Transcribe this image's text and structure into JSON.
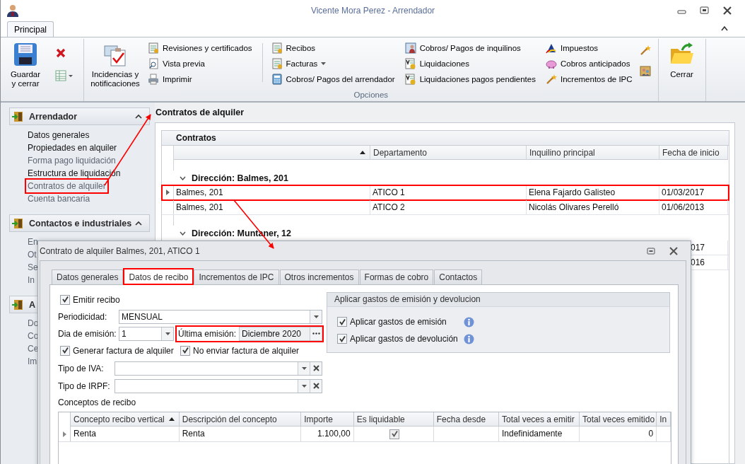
{
  "window": {
    "title": "Vicente Mora Perez - Arrendador"
  },
  "ribbon": {
    "tabs": [
      {
        "label": "Principal",
        "selected": true
      }
    ],
    "save_button": {
      "label": "Guardar y cerrar"
    },
    "main_button": {
      "label": "Incidencias y notificaciones"
    },
    "columns": [
      [
        {
          "label": "Revisiones y certificados",
          "dropdown": false
        },
        {
          "label": "Vista previa",
          "dropdown": false
        },
        {
          "label": "Imprimir",
          "dropdown": false
        }
      ],
      [
        {
          "label": "Recibos",
          "dropdown": false
        },
        {
          "label": "Facturas",
          "dropdown": true
        },
        {
          "label": "Cobros/ Pagos del arrendador",
          "dropdown": false
        }
      ],
      [
        {
          "label": "Cobros/ Pagos de inquilinos",
          "dropdown": false
        },
        {
          "label": "Liquidaciones",
          "dropdown": false
        },
        {
          "label": "Liquidaciones pagos pendientes",
          "dropdown": false
        }
      ],
      [
        {
          "label": "Impuestos",
          "dropdown": false
        },
        {
          "label": "Cobros anticipados",
          "dropdown": false
        },
        {
          "label": "Incrementos de IPC",
          "dropdown": false
        }
      ]
    ],
    "group_label": "Opciones",
    "close_button": {
      "label": "Cerrar"
    }
  },
  "sidebar": {
    "groups": [
      {
        "title": "Arrendador",
        "expanded": true,
        "items": [
          {
            "label": "Datos generales",
            "dimmed": false,
            "highlighted": false
          },
          {
            "label": "Propiedades en alquiler",
            "dimmed": false,
            "highlighted": false
          },
          {
            "label": "Forma pago liquidación",
            "dimmed": true,
            "highlighted": false
          },
          {
            "label": "Estructura de liquidación",
            "dimmed": false,
            "highlighted": false
          },
          {
            "label": "Contratos de alquiler",
            "dimmed": true,
            "highlighted": true
          },
          {
            "label": "Cuenta bancaria",
            "dimmed": true,
            "highlighted": false
          }
        ]
      },
      {
        "title": "Contactos e industriales",
        "expanded": true,
        "items": [
          {
            "label": "En",
            "dimmed": true,
            "highlighted": false
          },
          {
            "label": "Ot",
            "dimmed": true,
            "highlighted": false
          },
          {
            "label": "Se",
            "dimmed": true,
            "highlighted": false
          },
          {
            "label": "In",
            "dimmed": true,
            "highlighted": false
          }
        ]
      },
      {
        "title": "A",
        "expanded": true,
        "items": [
          {
            "label": "Do",
            "dimmed": true,
            "highlighted": false
          },
          {
            "label": "Co",
            "dimmed": true,
            "highlighted": false
          },
          {
            "label": "Ce",
            "dimmed": true,
            "highlighted": false
          },
          {
            "label": "Im",
            "dimmed": true,
            "highlighted": false
          }
        ]
      }
    ]
  },
  "contracts": {
    "title": "Contratos de alquiler",
    "grid_title": "Contratos",
    "columns": [
      {
        "sorted": true
      },
      {
        "label": "Departamento",
        "sorted": false
      },
      {
        "label": "Inquilino principal",
        "sorted": false
      },
      {
        "label": "Fecha de inicio",
        "sorted": false
      }
    ],
    "groups": [
      {
        "label": "Dirección: Balmes, 201",
        "expanded": true,
        "rows": [
          {
            "kind": "full",
            "selected": true,
            "highlighted": true,
            "cells": [
              "Balmes, 201",
              "ATICO 1",
              "Elena Fajardo Galisteo",
              "01/03/2017"
            ]
          },
          {
            "kind": "full",
            "selected": false,
            "highlighted": false,
            "cells": [
              "Balmes, 201",
              "ATICO 2",
              "Nicolás Olivares Perelló",
              "01/06/2013"
            ]
          }
        ]
      },
      {
        "label": "Dirección: Muntaner, 12",
        "expanded": true,
        "rows": [
          {
            "kind": "covered",
            "selected": false,
            "highlighted": false,
            "cells": [
              "017"
            ]
          },
          {
            "kind": "covered",
            "selected": false,
            "highlighted": false,
            "cells": [
              "016"
            ]
          }
        ]
      }
    ]
  },
  "dialog": {
    "title": "Contrato de alquiler Balmes, 201, ATICO 1",
    "tabs": [
      {
        "label": "Datos generales",
        "selected": false,
        "highlighted": false
      },
      {
        "label": "Datos de recibo",
        "selected": true,
        "highlighted": true
      },
      {
        "label": "Incrementos de IPC",
        "selected": false,
        "highlighted": false
      },
      {
        "label": "Otros incrementos",
        "selected": false,
        "highlighted": false
      },
      {
        "label": "Formas de cobro",
        "selected": false,
        "highlighted": false
      },
      {
        "label": "Contactos",
        "selected": false,
        "highlighted": false
      }
    ],
    "emit": {
      "label": "Emitir recibo",
      "checked": true
    },
    "periodicidad": {
      "label": "Periodicidad:",
      "value": "MENSUAL"
    },
    "dia": {
      "label": "Dia de emisión:",
      "value": "1"
    },
    "ultima": {
      "label": "Última emisión:",
      "value": "Diciembre 2020",
      "highlighted": true
    },
    "checks": [
      {
        "label": "Generar factura de alquiler",
        "checked": true
      },
      {
        "label": "No enviar factura de alquiler",
        "checked": true
      }
    ],
    "tax_fields": [
      {
        "label": "Tipo de IVA:"
      },
      {
        "label": "Tipo de IRPF:"
      }
    ],
    "gastos": {
      "title": "Aplicar gastos de emisión y devolucion",
      "options": [
        {
          "label": "Aplicar gastos de emisión",
          "checked": true
        },
        {
          "label": "Aplicar gastos de devolución",
          "checked": true
        }
      ]
    },
    "conceptos": {
      "title": "Conceptos de recibo",
      "columns": [
        {
          "label": "Concepto recibo vertical",
          "sorted": true
        },
        {
          "label": "Descripción del concepto",
          "sorted": false
        },
        {
          "label": "Importe",
          "sorted": false
        },
        {
          "label": "Es liquidable",
          "sorted": false
        },
        {
          "label": "Fecha desde",
          "sorted": false
        },
        {
          "label": "Total veces a emitir",
          "sorted": false
        },
        {
          "label": "Total veces emitido",
          "sorted": false
        },
        {
          "label": "In",
          "sorted": false
        }
      ],
      "rows": [
        {
          "selected": true,
          "concepto": "Renta",
          "descripcion": "Renta",
          "importe": "1.100,00",
          "liquidable": true,
          "total_emitir": "Indefinidamente",
          "total_emitido": "0"
        }
      ]
    }
  }
}
